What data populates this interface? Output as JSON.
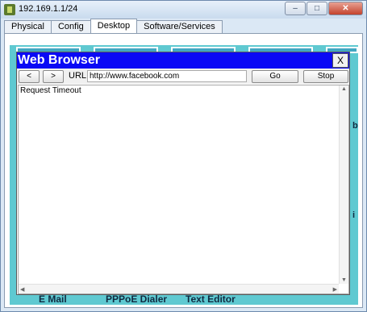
{
  "window": {
    "title": "192.169.1.1/24",
    "controls": {
      "minimize": "–",
      "maximize": "□",
      "close": "✕"
    }
  },
  "tabs": [
    {
      "label": "Physical",
      "active": false
    },
    {
      "label": "Config",
      "active": false
    },
    {
      "label": "Desktop",
      "active": true
    },
    {
      "label": "Software/Services",
      "active": false
    }
  ],
  "desktop": {
    "bottom_labels": [
      "E Mail",
      "PPPoE Dialer",
      "Text Editor"
    ],
    "right_edge_fragments": [
      "b",
      "i"
    ]
  },
  "browser": {
    "title": "Web Browser",
    "close_label": "X",
    "back_label": "<",
    "forward_label": ">",
    "url_label": "URL",
    "url_value": "http://www.facebook.com",
    "go_label": "Go",
    "stop_label": "Stop",
    "page_text": "Request Timeout"
  },
  "colors": {
    "browser_title_bar": "#0a09f5",
    "desktop_background": "#5fc9d1"
  },
  "icons": {
    "app": "packet-tracer-pc-icon",
    "scroll_up": "▲",
    "scroll_down": "▼",
    "scroll_left": "◀",
    "scroll_right": "▶"
  }
}
